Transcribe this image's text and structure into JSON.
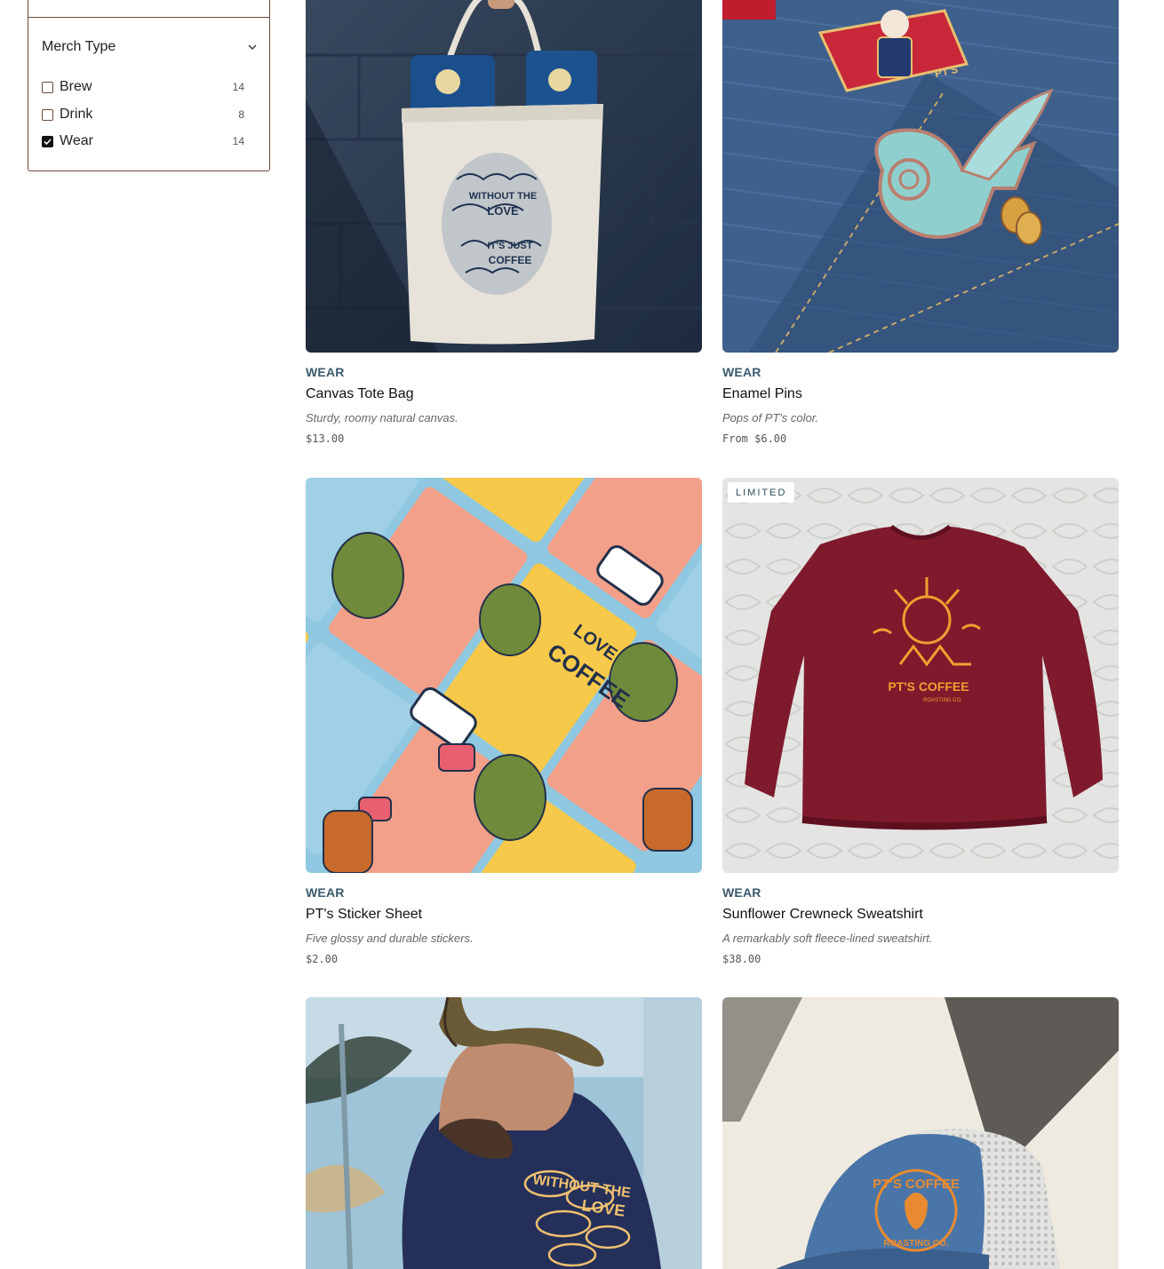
{
  "filter": {
    "title": "Merch Type",
    "options": [
      {
        "label": "Brew",
        "count": "14",
        "checked": false
      },
      {
        "label": "Drink",
        "count": "8",
        "checked": false
      },
      {
        "label": "Wear",
        "count": "14",
        "checked": true
      }
    ]
  },
  "products": [
    {
      "category": "WEAR",
      "name": "Canvas Tote Bag",
      "description": "Sturdy, roomy natural canvas.",
      "price": "$13.00"
    },
    {
      "category": "WEAR",
      "name": "Enamel Pins",
      "description": "Pops of PT's color.",
      "price": "From $6.00"
    },
    {
      "category": "WEAR",
      "name": "PT's Sticker Sheet",
      "description": "Five glossy and durable stickers.",
      "price": "$2.00"
    },
    {
      "category": "WEAR",
      "name": "Sunflower Crewneck Sweatshirt",
      "description": "A remarkably soft fleece-lined sweatshirt.",
      "price": "$38.00",
      "badge": "LIMITED"
    }
  ],
  "image_text": {
    "tote": "WITHOUT THE LOVE IT'S JUST COFFEE",
    "sticker": "LOVE COFFEE",
    "sweatshirt": "PT'S COFFEE",
    "hoodie": "WITHOUT THE LOVE",
    "cap": "PT'S COFFEE ROASTING CO."
  },
  "colors": {
    "category": "#3a5a6e",
    "border": "#6b4a3a",
    "sweatshirt": "#7e1a2c",
    "hoodie": "#24305a",
    "denim": "#3f5f8c"
  }
}
